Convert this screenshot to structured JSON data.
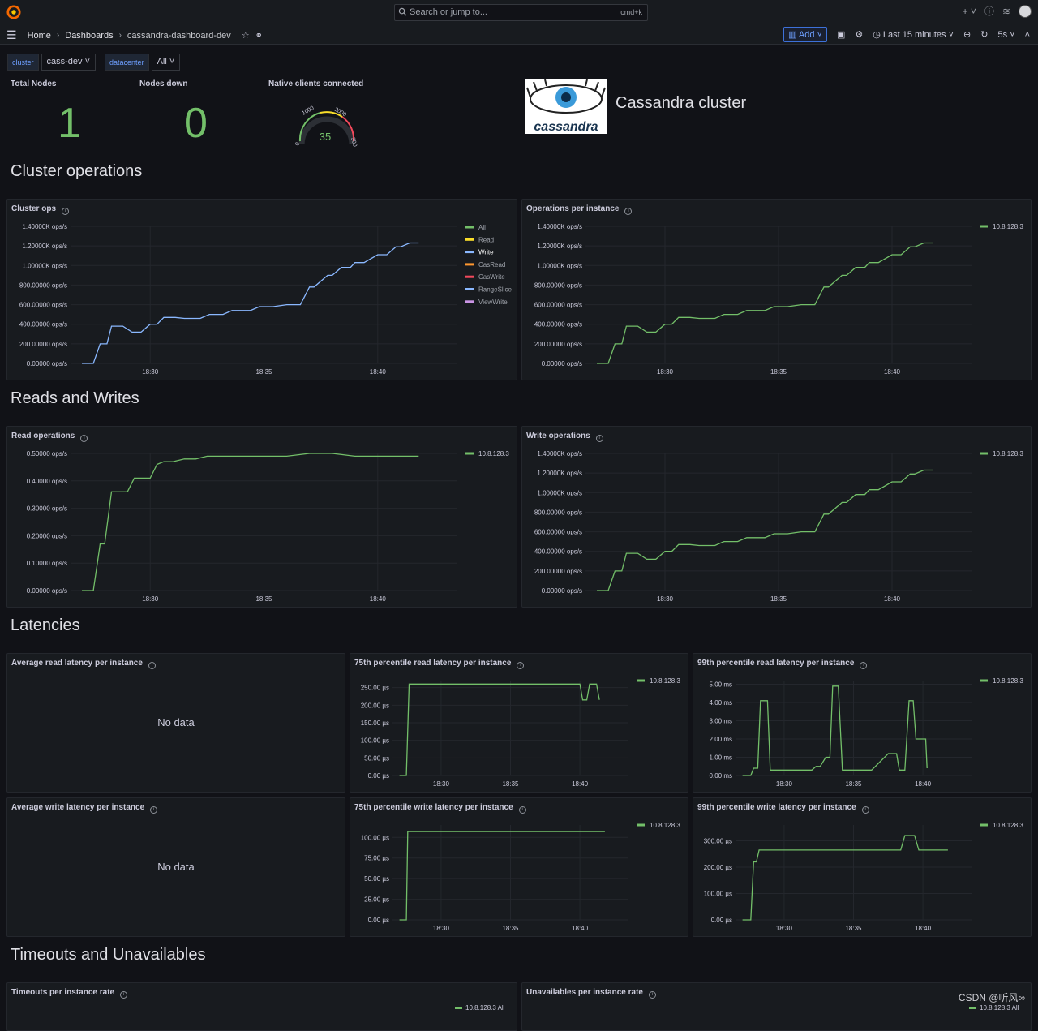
{
  "topbar": {
    "search_placeholder": "Search or jump to...",
    "shortcut": "cmd+k"
  },
  "nav": {
    "breadcrumbs": [
      "Home",
      "Dashboards",
      "cassandra-dashboard-dev"
    ],
    "add_label": "Add",
    "time_range": "Last 15 minutes",
    "refresh_interval": "5s"
  },
  "variables": [
    {
      "name": "cluster",
      "value": "cass-dev"
    },
    {
      "name": "datacenter",
      "value": "All"
    }
  ],
  "stats": {
    "total_nodes": {
      "title": "Total Nodes",
      "value": "1"
    },
    "nodes_down": {
      "title": "Nodes down",
      "value": "0"
    },
    "native_clients": {
      "title": "Native clients connected",
      "value": "35",
      "gauge_ticks": [
        "0",
        "1000",
        "2000",
        "300"
      ],
      "min": 0,
      "max": 3000
    }
  },
  "logo": {
    "text": "cassandra",
    "title": "Cassandra cluster"
  },
  "rows": {
    "cluster_operations": "Cluster operations",
    "reads_writes": "Reads and Writes",
    "latencies": "Latencies",
    "timeouts": "Timeouts and Unavailables"
  },
  "x_ticks": [
    "18:30",
    "18:35",
    "18:40"
  ],
  "colors": {
    "green": "#73bf69",
    "blue": "#8ab8ff",
    "yellow": "#fade2a",
    "orange": "#ff9830",
    "red": "#f2495c",
    "purple": "#ca95e5"
  },
  "panels": {
    "cluster_ops": {
      "title": "Cluster ops",
      "legend": [
        "All",
        "Read",
        "Write",
        "CasRead",
        "CasWrite",
        "RangeSlice",
        "ViewWrite"
      ]
    },
    "ops_per_instance": {
      "title": "Operations per instance",
      "legend": [
        "10.8.128.3"
      ]
    },
    "read_ops": {
      "title": "Read operations",
      "legend": [
        "10.8.128.3"
      ]
    },
    "write_ops": {
      "title": "Write operations",
      "legend": [
        "10.8.128.3"
      ]
    },
    "avg_read_latency": {
      "title": "Average read latency per instance",
      "message": "No data"
    },
    "p75_read_latency": {
      "title": "75th percentile read latency per instance",
      "legend": [
        "10.8.128.3"
      ]
    },
    "p99_read_latency": {
      "title": "99th percentile read latency per instance",
      "legend": [
        "10.8.128.3"
      ]
    },
    "avg_write_latency": {
      "title": "Average write latency per instance",
      "message": "No data"
    },
    "p75_write_latency": {
      "title": "75th percentile write latency per instance",
      "legend": [
        "10.8.128.3"
      ]
    },
    "p99_write_latency": {
      "title": "99th percentile write latency per instance",
      "legend": [
        "10.8.128.3"
      ]
    },
    "timeouts_rate": {
      "title": "Timeouts per instance rate",
      "legend": [
        "10.8.128.3 All"
      ]
    },
    "unavailables_rate": {
      "title": "Unavailables per instance rate",
      "legend": [
        "10.8.128.3 All"
      ]
    }
  },
  "watermark": "CSDN @听风∞",
  "chart_data": [
    {
      "id": "cluster_ops",
      "type": "line",
      "ylabels": [
        "0.00000 ops/s",
        "200.00000 ops/s",
        "400.00000 ops/s",
        "600.00000 ops/s",
        "800.00000 ops/s",
        "1.00000K ops/s",
        "1.20000K ops/s",
        "1.40000K ops/s"
      ],
      "ylim": [
        0,
        1400
      ],
      "series": [
        {
          "name": "Write",
          "color": "#8ab8ff",
          "x": [
            27.0,
            27.5,
            27.8,
            28.1,
            28.3,
            28.8,
            29.2,
            29.6,
            30.0,
            30.3,
            30.6,
            31.1,
            31.5,
            32.2,
            32.6,
            33.2,
            33.6,
            34.4,
            34.8,
            35.4,
            36.0,
            36.6,
            37.0,
            37.2,
            37.8,
            38.0,
            38.4,
            38.8,
            39.0,
            39.4,
            40.0,
            40.4,
            40.8,
            41.0,
            41.4,
            41.8
          ],
          "y": [
            0,
            0,
            200,
            200,
            380,
            380,
            320,
            320,
            400,
            400,
            470,
            470,
            460,
            460,
            500,
            500,
            540,
            540,
            580,
            580,
            600,
            600,
            780,
            780,
            900,
            900,
            980,
            980,
            1030,
            1030,
            1110,
            1110,
            1190,
            1190,
            1230,
            1230
          ]
        }
      ],
      "xlim": [
        26.5,
        43.5
      ]
    },
    {
      "id": "ops_per_instance",
      "type": "line",
      "ylabels": [
        "0.00000 ops/s",
        "200.00000 ops/s",
        "400.00000 ops/s",
        "600.00000 ops/s",
        "800.00000 ops/s",
        "1.00000K ops/s",
        "1.20000K ops/s",
        "1.40000K ops/s"
      ],
      "ylim": [
        0,
        1400
      ],
      "series": [
        {
          "name": "10.8.128.3",
          "color": "#73bf69",
          "x": [
            27.0,
            27.5,
            27.8,
            28.1,
            28.3,
            28.8,
            29.2,
            29.6,
            30.0,
            30.3,
            30.6,
            31.1,
            31.5,
            32.2,
            32.6,
            33.2,
            33.6,
            34.4,
            34.8,
            35.4,
            36.0,
            36.6,
            37.0,
            37.2,
            37.8,
            38.0,
            38.4,
            38.8,
            39.0,
            39.4,
            40.0,
            40.4,
            40.8,
            41.0,
            41.4,
            41.8
          ],
          "y": [
            0,
            0,
            200,
            200,
            380,
            380,
            320,
            320,
            400,
            400,
            470,
            470,
            460,
            460,
            500,
            500,
            540,
            540,
            580,
            580,
            600,
            600,
            780,
            780,
            900,
            900,
            980,
            980,
            1030,
            1030,
            1110,
            1110,
            1190,
            1190,
            1230,
            1230
          ]
        }
      ],
      "xlim": [
        26.5,
        43.5
      ]
    },
    {
      "id": "read_ops",
      "type": "line",
      "ylabels": [
        "0.00000 ops/s",
        "0.10000 ops/s",
        "0.20000 ops/s",
        "0.30000 ops/s",
        "0.40000 ops/s",
        "0.50000 ops/s"
      ],
      "ylim": [
        0,
        0.5
      ],
      "series": [
        {
          "name": "10.8.128.3",
          "color": "#73bf69",
          "x": [
            27.0,
            27.5,
            27.8,
            28.0,
            28.3,
            29.0,
            29.3,
            30.0,
            30.3,
            30.6,
            31.0,
            31.5,
            32.0,
            32.5,
            33.0,
            34.0,
            34.8,
            35.5,
            36.0,
            37.0,
            38.0,
            39.0,
            40.0,
            41.0,
            41.8
          ],
          "y": [
            0,
            0,
            0.17,
            0.17,
            0.36,
            0.36,
            0.41,
            0.41,
            0.46,
            0.47,
            0.47,
            0.48,
            0.48,
            0.49,
            0.49,
            0.49,
            0.49,
            0.49,
            0.49,
            0.5,
            0.5,
            0.49,
            0.49,
            0.49,
            0.49
          ]
        }
      ],
      "xlim": [
        26.5,
        43.5
      ]
    },
    {
      "id": "write_ops",
      "type": "line",
      "ylabels": [
        "0.00000 ops/s",
        "200.00000 ops/s",
        "400.00000 ops/s",
        "600.00000 ops/s",
        "800.00000 ops/s",
        "1.00000K ops/s",
        "1.20000K ops/s",
        "1.40000K ops/s"
      ],
      "ylim": [
        0,
        1400
      ],
      "series": [
        {
          "name": "10.8.128.3",
          "color": "#73bf69",
          "x": [
            27.0,
            27.5,
            27.8,
            28.1,
            28.3,
            28.8,
            29.2,
            29.6,
            30.0,
            30.3,
            30.6,
            31.1,
            31.5,
            32.2,
            32.6,
            33.2,
            33.6,
            34.4,
            34.8,
            35.4,
            36.0,
            36.6,
            37.0,
            37.2,
            37.8,
            38.0,
            38.4,
            38.8,
            39.0,
            39.4,
            40.0,
            40.4,
            40.8,
            41.0,
            41.4,
            41.8
          ],
          "y": [
            0,
            0,
            200,
            200,
            380,
            380,
            320,
            320,
            400,
            400,
            470,
            470,
            460,
            460,
            500,
            500,
            540,
            540,
            580,
            580,
            600,
            600,
            780,
            780,
            900,
            900,
            980,
            980,
            1030,
            1030,
            1110,
            1110,
            1190,
            1190,
            1230,
            1230
          ]
        }
      ],
      "xlim": [
        26.5,
        43.5
      ]
    },
    {
      "id": "p75_read_latency",
      "type": "line",
      "ylabels": [
        "0.00 µs",
        "50.00 µs",
        "100.00 µs",
        "150.00 µs",
        "200.00 µs",
        "250.00 µs"
      ],
      "ylim": [
        0,
        270
      ],
      "series": [
        {
          "name": "10.8.128.3",
          "color": "#73bf69",
          "x": [
            27.0,
            27.5,
            27.7,
            40.0,
            40.2,
            40.5,
            40.7,
            41.2,
            41.4
          ],
          "y": [
            0,
            0,
            260,
            260,
            215,
            215,
            260,
            260,
            215
          ]
        }
      ],
      "xlim": [
        26.5,
        43.5
      ]
    },
    {
      "id": "p99_read_latency",
      "type": "line",
      "ylabels": [
        "0.00 ms",
        "1.00 ms",
        "2.00 ms",
        "3.00 ms",
        "4.00 ms",
        "5.00 ms"
      ],
      "ylim": [
        0,
        5.2
      ],
      "series": [
        {
          "name": "10.8.128.3",
          "color": "#73bf69",
          "x": [
            27.0,
            27.6,
            27.8,
            28.1,
            28.3,
            28.8,
            29.0,
            32.0,
            32.3,
            32.6,
            33.0,
            33.3,
            33.5,
            33.9,
            34.2,
            35.7,
            36.3,
            37.5,
            38.1,
            38.3,
            38.7,
            39.0,
            39.3,
            39.5,
            40.2,
            40.3
          ],
          "y": [
            0,
            0,
            0.4,
            0.4,
            4.1,
            4.1,
            0.3,
            0.3,
            0.5,
            0.5,
            1.0,
            1.0,
            4.9,
            4.9,
            0.3,
            0.3,
            0.3,
            1.2,
            1.2,
            0.3,
            0.3,
            4.1,
            4.1,
            2.0,
            2.0,
            0.4
          ]
        }
      ],
      "xlim": [
        26.5,
        43.5
      ]
    },
    {
      "id": "p75_write_latency",
      "type": "line",
      "ylabels": [
        "0.00 µs",
        "25.00 µs",
        "50.00 µs",
        "75.00 µs",
        "100.00 µs"
      ],
      "ylim": [
        0,
        115
      ],
      "series": [
        {
          "name": "10.8.128.3",
          "color": "#73bf69",
          "x": [
            27.0,
            27.5,
            27.6,
            41.8
          ],
          "y": [
            0,
            0,
            107,
            107
          ]
        }
      ],
      "xlim": [
        26.5,
        43.5
      ]
    },
    {
      "id": "p99_write_latency",
      "type": "line",
      "ylabels": [
        "0.00 µs",
        "100.00 µs",
        "200.00 µs",
        "300.00 µs"
      ],
      "ylim": [
        0,
        360
      ],
      "series": [
        {
          "name": "10.8.128.3",
          "color": "#73bf69",
          "x": [
            27.0,
            27.6,
            27.8,
            28.0,
            28.2,
            28.5,
            38.4,
            38.7,
            39.4,
            39.7,
            41.8
          ],
          "y": [
            0,
            0,
            220,
            220,
            265,
            265,
            265,
            320,
            320,
            265,
            265
          ]
        }
      ],
      "xlim": [
        26.5,
        43.5
      ]
    }
  ]
}
